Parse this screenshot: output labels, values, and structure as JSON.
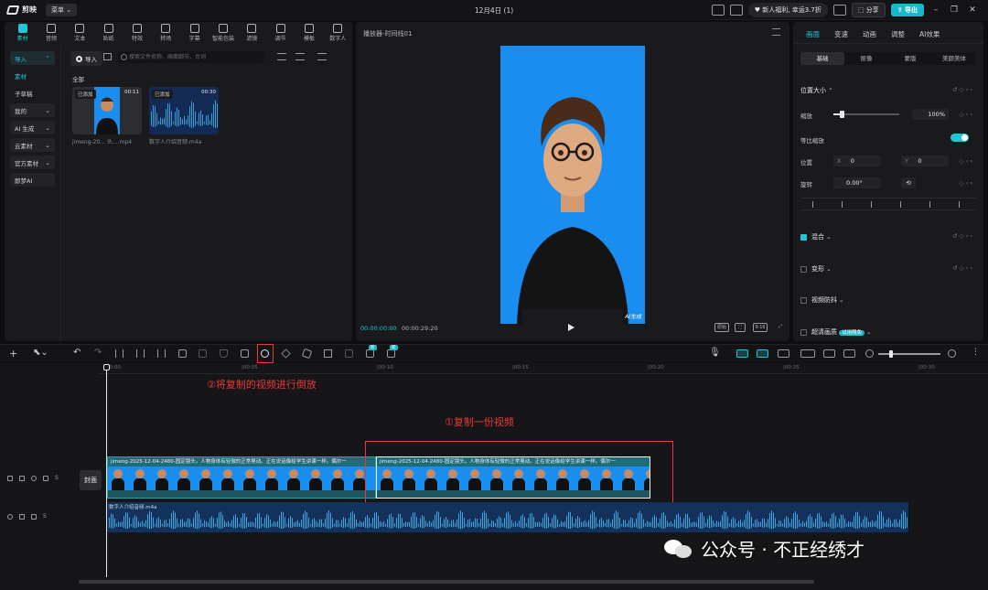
{
  "titlebar": {
    "app_name": "剪映",
    "menu_label": "菜单",
    "project_title": "12月4日 (1)",
    "promo": "新人福利, 幸运3.7折",
    "share_label": "分享",
    "export_label": "导出"
  },
  "media_panel": {
    "tabs": [
      {
        "label": "素材",
        "icon": "media-icon",
        "active": true
      },
      {
        "label": "音频",
        "icon": "audio-icon"
      },
      {
        "label": "文本",
        "icon": "text-icon"
      },
      {
        "label": "贴纸",
        "icon": "sticker-icon"
      },
      {
        "label": "特效",
        "icon": "effects-icon"
      },
      {
        "label": "转场",
        "icon": "transition-icon"
      },
      {
        "label": "字幕",
        "icon": "caption-icon"
      },
      {
        "label": "智能包装",
        "icon": "smart-pack-icon"
      },
      {
        "label": "滤镜",
        "icon": "filter-icon"
      },
      {
        "label": "调节",
        "icon": "adjust-icon"
      },
      {
        "label": "模板",
        "icon": "template-icon"
      },
      {
        "label": "数字人",
        "icon": "avatar-icon"
      }
    ],
    "sidebar": [
      {
        "label": "导入",
        "chevron": "⌃",
        "active": true
      },
      {
        "label": "素材",
        "sub": true
      },
      {
        "label": "子草稿",
        "plain": true
      },
      {
        "label": "我的",
        "chevron": "⌄"
      },
      {
        "label": "AI 生成",
        "chevron": "⌄"
      },
      {
        "label": "云素材",
        "chevron": "⌄"
      },
      {
        "label": "官方素材",
        "chevron": "⌄"
      },
      {
        "label": "即梦AI"
      }
    ],
    "import_label": "导入",
    "search_placeholder": "搜索文件名称、画面细节、台词",
    "all_label": "全部",
    "items": [
      {
        "badge": "已添加",
        "duration": "00:11",
        "name": "jimeng-20... 头....mp4",
        "kind": "video"
      },
      {
        "badge": "已添加",
        "duration": "00:30",
        "name": "数字人介绍音频.m4a",
        "kind": "audio"
      }
    ]
  },
  "player": {
    "title": "播放器-时间线01",
    "current_time": "00:00:00:00",
    "total_time": "00:00:29:20",
    "watermark": "AI生成",
    "controls": [
      "原始",
      "⛶",
      "9:16",
      "⤢"
    ]
  },
  "properties": {
    "tabs": [
      "画面",
      "变速",
      "动画",
      "调整",
      "AI效果"
    ],
    "active_tab": "画面",
    "subtabs": [
      "基础",
      "抠像",
      "蒙版",
      "美颜美体"
    ],
    "active_subtab": "基础",
    "section_position": "位置大小",
    "scale_label": "缩放",
    "scale_value": "100%",
    "scale_level": 0.12,
    "uniform_scale_label": "等比缩放",
    "position_label": "位置",
    "pos_x_label": "X",
    "pos_x": "0",
    "pos_y_label": "Y",
    "pos_y": "0",
    "rotate_label": "旋转",
    "rotate_value": "0.00°",
    "blend_label": "混合",
    "transform_label": "变形",
    "stabilize_label": "视频防抖",
    "hd_label": "超清画质",
    "hd_badge": "试用限免"
  },
  "timeline": {
    "ruler": [
      "00:00",
      "|00:05",
      "|00:10",
      "|00:15",
      "|00:20",
      "|00:25",
      "|00:30"
    ],
    "cover_label": "封面",
    "clip1_title": "jimeng-2025-12-04-2480-固定镜头。人物身体有轻微的正常晃动。正在说话像给学生讲课一样。偶尔一",
    "clip2_title": "jimeng-2025-12-04-2480-固定镜头。人物身体有轻微的正常晃动。正在说话像给学生讲课一样。偶尔一",
    "audio_name": "数字人介绍音频.m4a",
    "annotation_reverse": "②将复制的视频进行倒放",
    "annotation_copy": "①复制一份视频",
    "watermark_text": "公众号 · 不正经绣才"
  },
  "colors": {
    "accent": "#22c6d8",
    "annotation": "#e53b3b",
    "canvas_bg": "#1a8ef0"
  }
}
